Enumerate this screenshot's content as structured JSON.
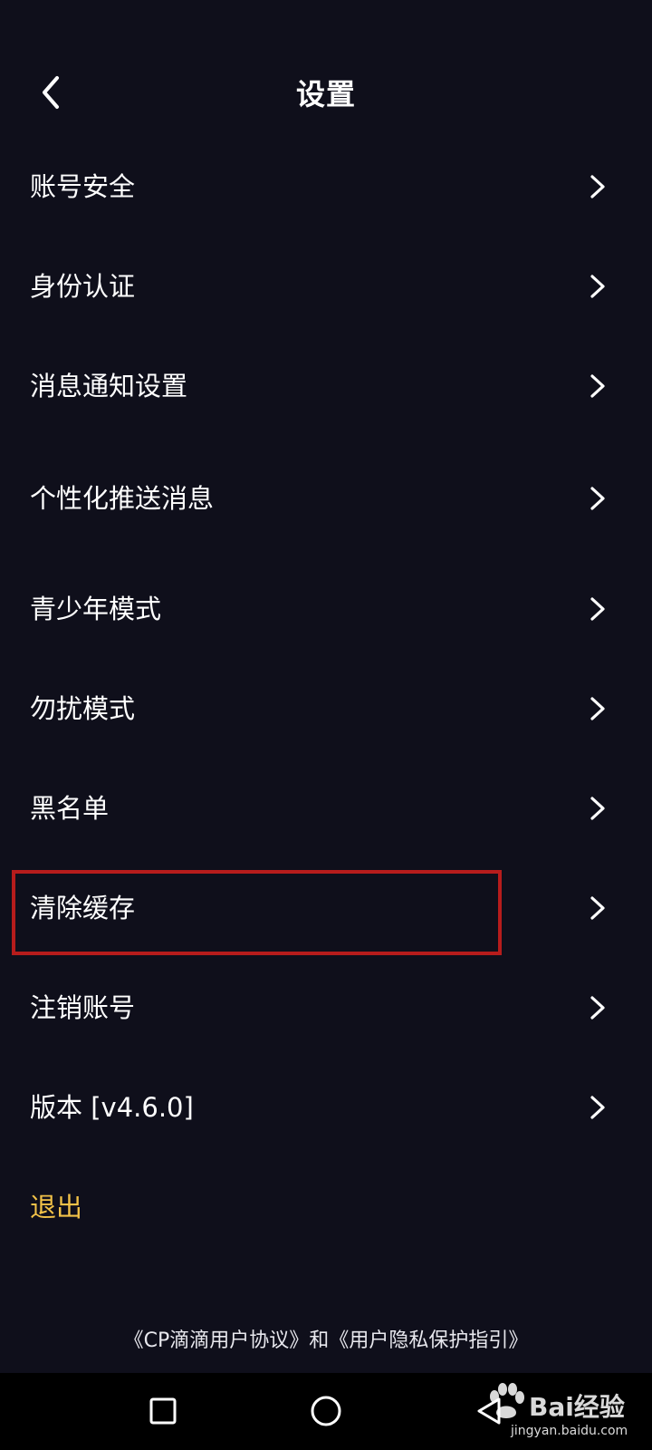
{
  "header": {
    "title": "设置"
  },
  "menu": [
    {
      "label": "账号安全"
    },
    {
      "label": "身份认证"
    },
    {
      "label": "消息通知设置"
    },
    {
      "label": "个性化推送消息"
    },
    {
      "label": "青少年模式"
    },
    {
      "label": "勿扰模式"
    },
    {
      "label": "黑名单"
    },
    {
      "label": "清除缓存",
      "highlighted": true
    },
    {
      "label": "注销账号"
    },
    {
      "label": "版本 [v4.6.0]"
    }
  ],
  "logout_label": "退出",
  "footer": {
    "user_agreement": "《CP滴滴用户协议》",
    "conjunction": "和",
    "privacy_guide": "《用户隐私保护指引》"
  },
  "watermark": {
    "brand": "Bai",
    "brand_suffix": "经验",
    "domain": "jingyan.baidu.com"
  },
  "colors": {
    "background": "#0f0f1b",
    "text": "#ffffff",
    "logout": "#f2c248",
    "highlight_border": "#b61c1c",
    "navbar": "#000000"
  },
  "icons": {
    "back": "chevron-left-icon",
    "row_arrow": "chevron-right-icon",
    "nav_recent": "square-icon",
    "nav_home": "circle-icon",
    "nav_back": "triangle-left-icon",
    "watermark": "paw-icon"
  }
}
